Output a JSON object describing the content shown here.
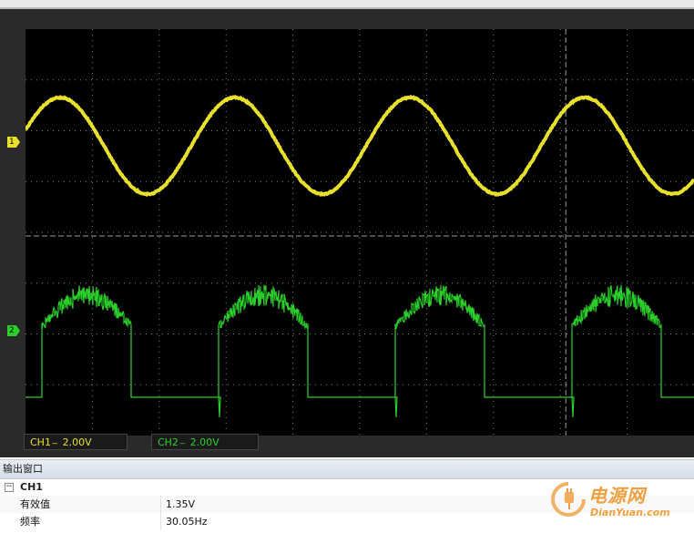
{
  "scope": {
    "channels": [
      {
        "id": "ch1",
        "marker": "1",
        "color": "#e8e02a",
        "scale_label": "CH1",
        "scale_value": "2.00V"
      },
      {
        "id": "ch2",
        "marker": "2",
        "color": "#2ad02a",
        "scale_label": "CH2",
        "scale_value": "2.00V"
      }
    ],
    "coupling_glyph": "---",
    "grid": true,
    "grid_divisions": {
      "x": 10,
      "y": 8
    }
  },
  "output_panel": {
    "title": "输出窗口",
    "group": {
      "toggle": "−",
      "name": "CH1"
    },
    "rows": [
      {
        "name": "有效值",
        "value": "1.35V"
      },
      {
        "name": "频率",
        "value": "30.05Hz"
      }
    ]
  },
  "watermark": {
    "cn": "电源网",
    "en": "DianYuan.com"
  },
  "colors": {
    "screen": "#000000",
    "frame": "#2a2a2a",
    "ch1": "#e8e02a",
    "ch2": "#2ad02a",
    "watermark": "#f0a040"
  }
}
